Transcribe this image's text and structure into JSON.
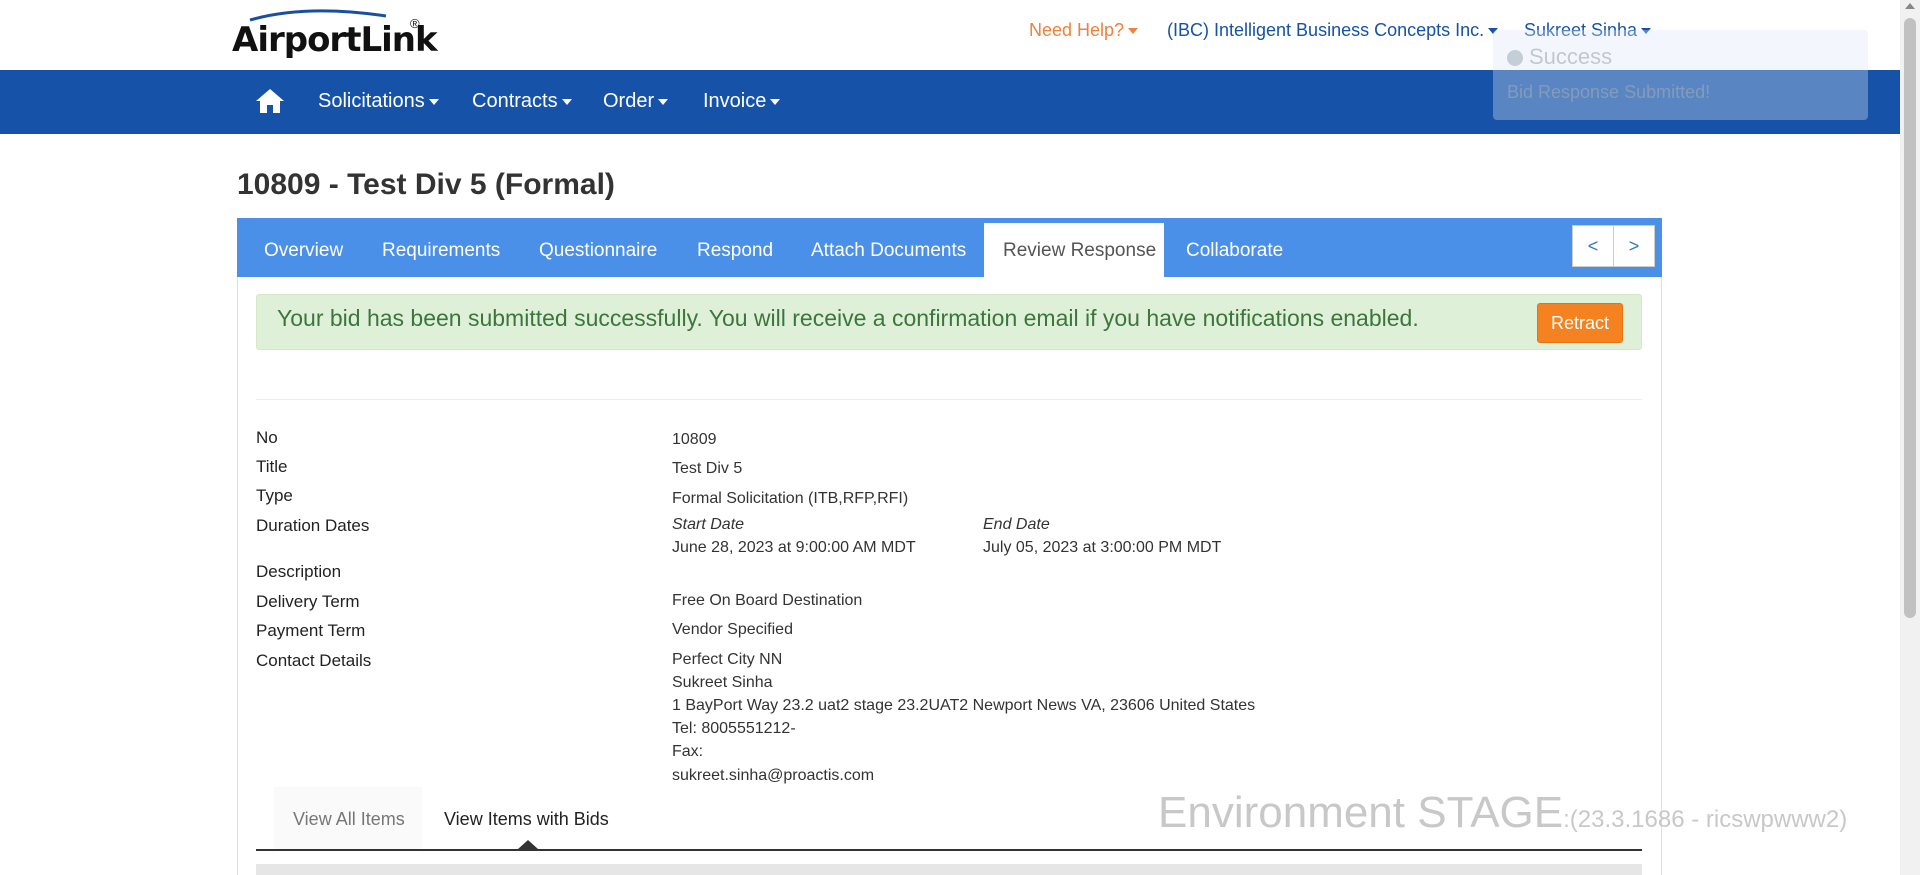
{
  "header": {
    "logo_text": "AirportLink",
    "logo_reg": "®",
    "help_label": "Need Help?",
    "company_label": "(IBC) Intelligent Business Concepts Inc.",
    "user_label": "Sukreet Sinha"
  },
  "nav": {
    "items": [
      {
        "label": "Solicitations"
      },
      {
        "label": "Contracts"
      },
      {
        "label": "Order"
      },
      {
        "label": "Invoice"
      }
    ]
  },
  "toast": {
    "title": "Success",
    "message": "Bid Response Submitted!"
  },
  "page": {
    "title": "10809 - Test Div 5 (Formal)"
  },
  "tabs": [
    {
      "label": "Overview"
    },
    {
      "label": "Requirements"
    },
    {
      "label": "Questionnaire"
    },
    {
      "label": "Respond"
    },
    {
      "label": "Attach Documents"
    },
    {
      "label": "Review Response"
    },
    {
      "label": "Collaborate"
    }
  ],
  "pager": {
    "prev": "<",
    "next": ">"
  },
  "alert": {
    "text": "Your bid has been submitted successfully. You will receive a confirmation email if you have notifications enabled.",
    "retract_label": "Retract"
  },
  "details": {
    "no_label": "No",
    "no_value": "10809",
    "title_label": "Title",
    "title_value": "Test Div 5",
    "type_label": "Type",
    "type_value": "Formal Solicitation (ITB,RFP,RFI)",
    "duration_label": "Duration Dates",
    "start_label": "Start Date",
    "start_value": "June 28, 2023 at 9:00:00 AM MDT",
    "end_label": "End Date",
    "end_value": "July 05, 2023 at 3:00:00 PM MDT",
    "description_label": "Description",
    "delivery_label": "Delivery Term",
    "delivery_value": "Free On Board Destination",
    "payment_label": "Payment Term",
    "payment_value": "Vendor Specified",
    "contact_label": "Contact Details",
    "contact_lines": [
      "Perfect City NN",
      "Sukreet Sinha",
      "1 BayPort Way 23.2 uat2 stage 23.2UAT2 Newport News VA, 23606 United States",
      "Tel: 8005551212-",
      "Fax:",
      "sukreet.sinha@proactis.com"
    ]
  },
  "subtabs": {
    "all_items": "View All Items",
    "items_with_bids": "View Items with Bids"
  },
  "environment": {
    "label": "Environment STAGE",
    "version": ":(23.3.1686 - ricswpwww2)"
  },
  "colors": {
    "navbar": "#1552a8",
    "tabs": "#4a8fe8",
    "help": "#f0803c",
    "link": "#1552a8",
    "retract": "#f58220",
    "alert_bg": "#dff0d8"
  },
  "icons": {
    "home": "home-icon",
    "toast_check": "check-circle-icon"
  }
}
